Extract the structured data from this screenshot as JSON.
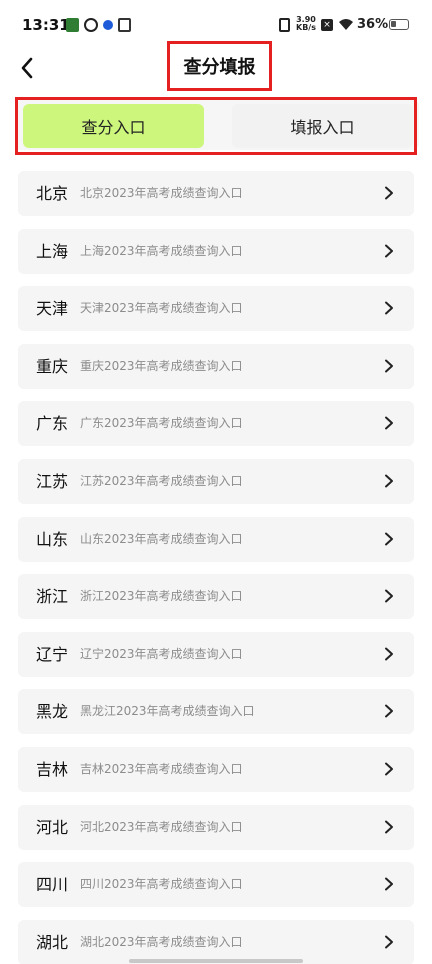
{
  "status_bar": {
    "time": "13:31",
    "net_speed_value": "3.90",
    "net_speed_unit": "KB/s",
    "battery": "36%",
    "battery_level": 0.36
  },
  "header": {
    "title": "查分填报",
    "back_icon": "chevron-left-icon"
  },
  "tabs": [
    {
      "label": "查分入口",
      "active": true
    },
    {
      "label": "填报入口",
      "active": false
    }
  ],
  "colors": {
    "active_tab": "#cdf77c",
    "highlight_border": "#e52020",
    "item_bg": "#f5f5f5"
  },
  "list": [
    {
      "province": "北京",
      "desc": "北京2023年高考成绩查询入口"
    },
    {
      "province": "上海",
      "desc": "上海2023年高考成绩查询入口"
    },
    {
      "province": "天津",
      "desc": "天津2023年高考成绩查询入口"
    },
    {
      "province": "重庆",
      "desc": "重庆2023年高考成绩查询入口"
    },
    {
      "province": "广东",
      "desc": "广东2023年高考成绩查询入口"
    },
    {
      "province": "江苏",
      "desc": "江苏2023年高考成绩查询入口"
    },
    {
      "province": "山东",
      "desc": "山东2023年高考成绩查询入口"
    },
    {
      "province": "浙江",
      "desc": "浙江2023年高考成绩查询入口"
    },
    {
      "province": "辽宁",
      "desc": "辽宁2023年高考成绩查询入口"
    },
    {
      "province": "黑龙",
      "desc": "黑龙江2023年高考成绩查询入口"
    },
    {
      "province": "吉林",
      "desc": "吉林2023年高考成绩查询入口"
    },
    {
      "province": "河北",
      "desc": "河北2023年高考成绩查询入口"
    },
    {
      "province": "四川",
      "desc": "四川2023年高考成绩查询入口"
    },
    {
      "province": "湖北",
      "desc": "湖北2023年高考成绩查询入口"
    }
  ]
}
